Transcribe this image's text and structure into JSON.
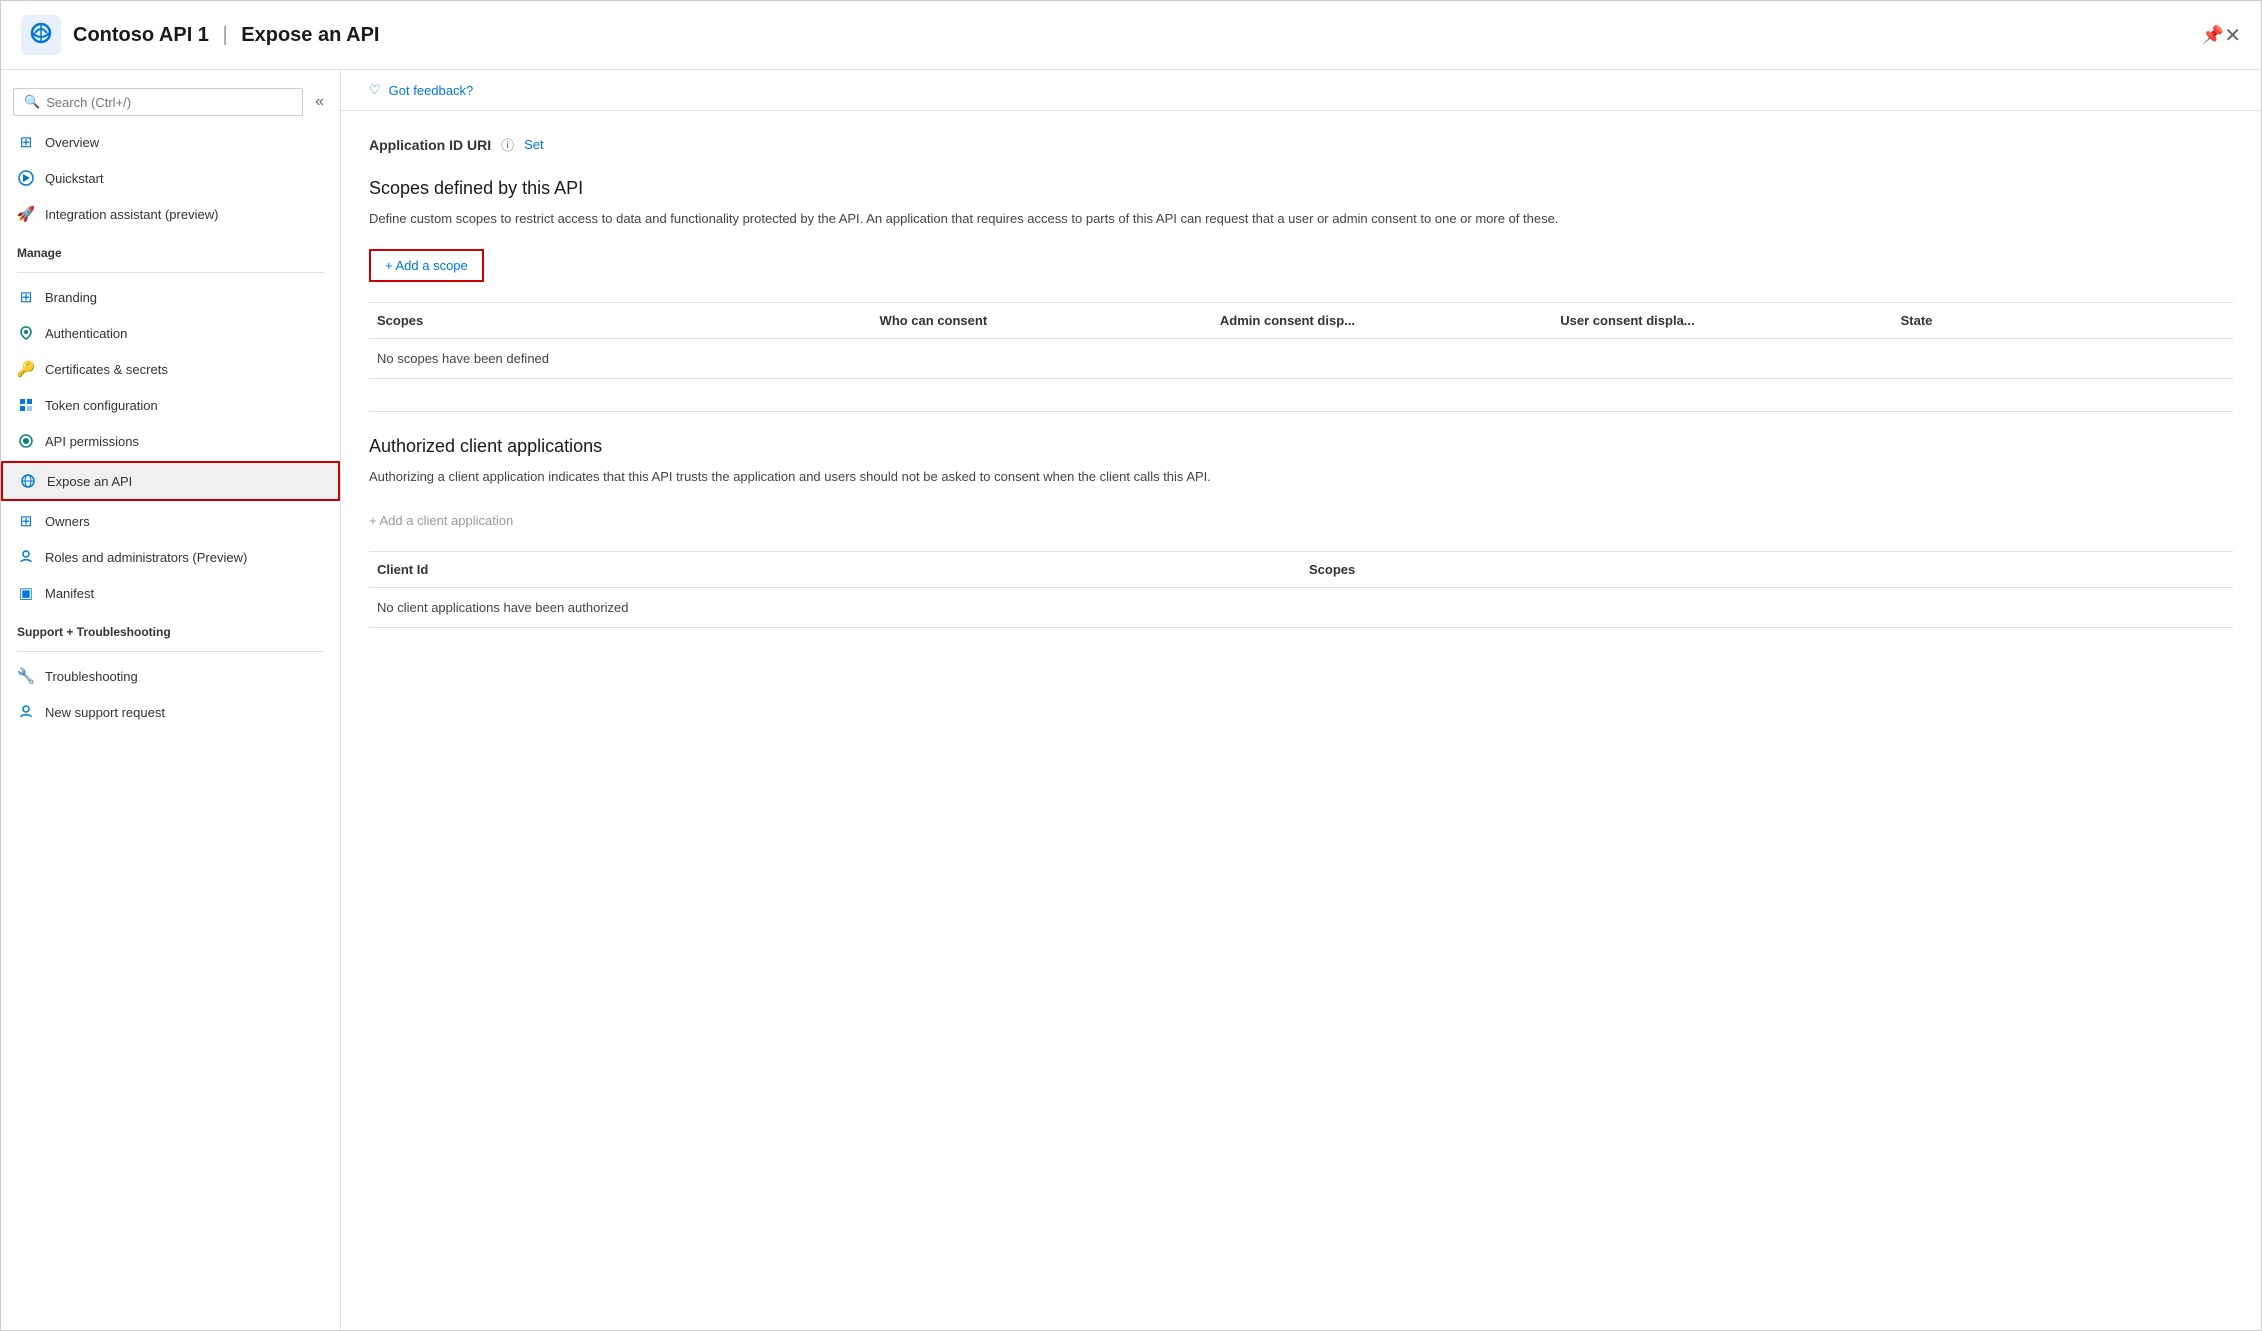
{
  "header": {
    "app_name": "Contoso API 1",
    "separator": "|",
    "page_title": "Expose an API",
    "pin_icon": "📌",
    "close_icon": "✕"
  },
  "sidebar": {
    "search_placeholder": "Search (Ctrl+/)",
    "collapse_icon": "«",
    "items": [
      {
        "id": "overview",
        "label": "Overview",
        "icon": "⊞",
        "icon_color": "blue"
      },
      {
        "id": "quickstart",
        "label": "Quickstart",
        "icon": "☁",
        "icon_color": "blue"
      },
      {
        "id": "integration-assistant",
        "label": "Integration assistant (preview)",
        "icon": "🚀",
        "icon_color": "orange"
      }
    ],
    "manage_label": "Manage",
    "manage_items": [
      {
        "id": "branding",
        "label": "Branding",
        "icon": "⊞",
        "icon_color": "blue"
      },
      {
        "id": "authentication",
        "label": "Authentication",
        "icon": "↻",
        "icon_color": "teal"
      },
      {
        "id": "certificates",
        "label": "Certificates & secrets",
        "icon": "🔑",
        "icon_color": "yellow"
      },
      {
        "id": "token-config",
        "label": "Token configuration",
        "icon": "▦",
        "icon_color": "blue"
      },
      {
        "id": "api-permissions",
        "label": "API permissions",
        "icon": "⊙",
        "icon_color": "teal"
      },
      {
        "id": "expose-api",
        "label": "Expose an API",
        "icon": "☁",
        "icon_color": "blue",
        "active": true
      },
      {
        "id": "owners",
        "label": "Owners",
        "icon": "⊞",
        "icon_color": "blue"
      },
      {
        "id": "roles",
        "label": "Roles and administrators (Preview)",
        "icon": "👤",
        "icon_color": "blue"
      },
      {
        "id": "manifest",
        "label": "Manifest",
        "icon": "▣",
        "icon_color": "blue"
      }
    ],
    "support_label": "Support + Troubleshooting",
    "support_items": [
      {
        "id": "troubleshooting",
        "label": "Troubleshooting",
        "icon": "🔧",
        "icon_color": "gray"
      },
      {
        "id": "new-support",
        "label": "New support request",
        "icon": "👤",
        "icon_color": "blue"
      }
    ]
  },
  "feedback": {
    "icon": "♡",
    "label": "Got feedback?"
  },
  "main": {
    "app_id_uri_label": "Application ID URI",
    "app_id_uri_set": "Set",
    "scopes_section_title": "Scopes defined by this API",
    "scopes_section_desc": "Define custom scopes to restrict access to data and functionality protected by the API. An application that requires access to parts of this API can request that a user or admin consent to one or more of these.",
    "add_scope_label": "+ Add a scope",
    "scopes_table": {
      "columns": [
        "Scopes",
        "Who can consent",
        "Admin consent disp...",
        "User consent displa...",
        "State"
      ],
      "empty_message": "No scopes have been defined"
    },
    "authorized_section_title": "Authorized client applications",
    "authorized_section_desc": "Authorizing a client application indicates that this API trusts the application and users should not be asked to consent when the client calls this API.",
    "add_client_label": "+ Add a client application",
    "client_table": {
      "columns": [
        "Client Id",
        "Scopes"
      ],
      "empty_message": "No client applications have been authorized"
    }
  }
}
